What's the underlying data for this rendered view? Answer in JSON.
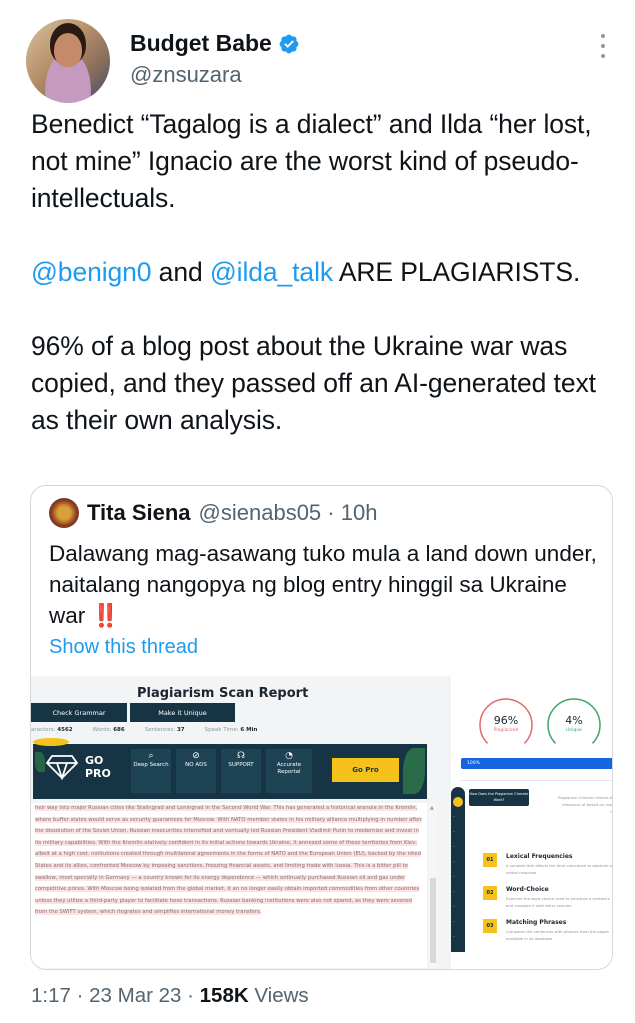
{
  "author": {
    "display_name": "Budget Babe",
    "handle": "@znsuzara",
    "verified": true,
    "icons": {
      "verified": "verified-badge-icon",
      "more": "more-vertical-icon"
    }
  },
  "tweet": {
    "line1": "Benedict “Tagalog is a dialect” and Ilda “her lost, not mine” Ignacio are the worst kind of pseudo-intellectuals.",
    "mention1": "@benign0",
    "and_text": " and ",
    "mention2": "@ilda_talk",
    "after_mentions": " ARE PLAGIARISTS.",
    "line3": "96% of a blog post about the Ukraine war was copied, and they passed off an AI-generated text as their own analysis."
  },
  "quote": {
    "display_name": "Tita Siena",
    "handle": "@sienabs05",
    "separator": " · ",
    "time": "10h",
    "text": "Dalawang mag-asawang tuko mula a land down under, naitalang nangopya ng blog entry hinggil sa Ukraine war ",
    "emoji": "‼️",
    "show_thread": "Show this thread"
  },
  "report": {
    "title": "Plagiarism Scan Report",
    "buttons": [
      "Check Grammar",
      "Make it Unique"
    ],
    "stats": [
      {
        "label": "aracters: ",
        "value": "4562"
      },
      {
        "label": "Words: ",
        "value": "686"
      },
      {
        "label": "Sentences: ",
        "value": "37"
      },
      {
        "label": "Speak Time: ",
        "value": "6 Min"
      }
    ],
    "gopro": {
      "logo_line1": "GO",
      "logo_line2": "PRO",
      "features": [
        {
          "icon": "search-icon",
          "glyph": "⌕",
          "label": "Deep Search"
        },
        {
          "icon": "no-ads-icon",
          "glyph": "⊘",
          "label": "NO ADS"
        },
        {
          "icon": "headset-icon",
          "glyph": "☊",
          "label": "SUPPORT"
        },
        {
          "icon": "pie-chart-icon",
          "glyph": "◔",
          "label": "Accurate Reportal"
        }
      ],
      "cta": "Go Pro"
    },
    "paragraph": "heir way into major Russian cities like Stalingrad and Leningrad in the Second World War.  This has generated a historical aranoia in the Kremlin, where buffer states would serve as security guarantees for Moscow.  With NATO member states in his military alliance multiplying in number after the dissolution of the Soviet Union, Russian insecurities intensified and ventually led Russian President Vladimir Putin to modernize  and invest in its military capabilities.  With the Kremlin elatively confident in its initial actions towards Ukraine, it annexed some of these territories from Kiev, albeit at a high cost. nstitutions created through multilateral agreements in the forms of NATO and the European Union (EU), backed by the nited States and its allies, confronted Moscow by imposing sanctions, freezing financial  assets, and limiting trade with lussia.  This is a bitter pill to swallow, most specially in Germany — a country known for its energy dependence — which ontinually purchased Russian oil and gas under competitive prices.   With Moscow being isolated from the global market, it an no longer easily obtain imported commodities from other countries unless they utilize a third-party player to facilitate hose transactions.   Russian banking institutions were also not spared, as they were severed from the SWIFT system, which itegrates and simplifies international money transfers.",
    "results": {
      "plagiarized": {
        "value": "96%",
        "label": "Plagiarized",
        "fraction": 0.96,
        "color": "#e06a6a"
      },
      "unique": {
        "value": "4%",
        "label": "Unique",
        "fraction": 0.04,
        "color": "#3aa66a"
      },
      "progress_label": "100%",
      "progress": 1.0
    },
    "tooltip": "How Does the Plagiarism Checker Work?",
    "intro_text": "Plagiarism Checker checks the relevance of based on many fac",
    "features": [
      {
        "num": "01",
        "title": "Lexical Frequencies",
        "desc": "A variable that affects the time consumed to absolute a verbal response"
      },
      {
        "num": "02",
        "title": "Word-Choice",
        "desc": "Examine the word choice used to structure a sentence and compare it with other sources."
      },
      {
        "num": "03",
        "title": "Matching Phrases",
        "desc": "Compares the sentences with phrases from the pages available in its database"
      }
    ]
  },
  "meta": {
    "time": "1:17",
    "sep1": " · ",
    "date": "23 Mar 23",
    "sep2": " · ",
    "views_count": "158K",
    "views_label": " Views"
  }
}
